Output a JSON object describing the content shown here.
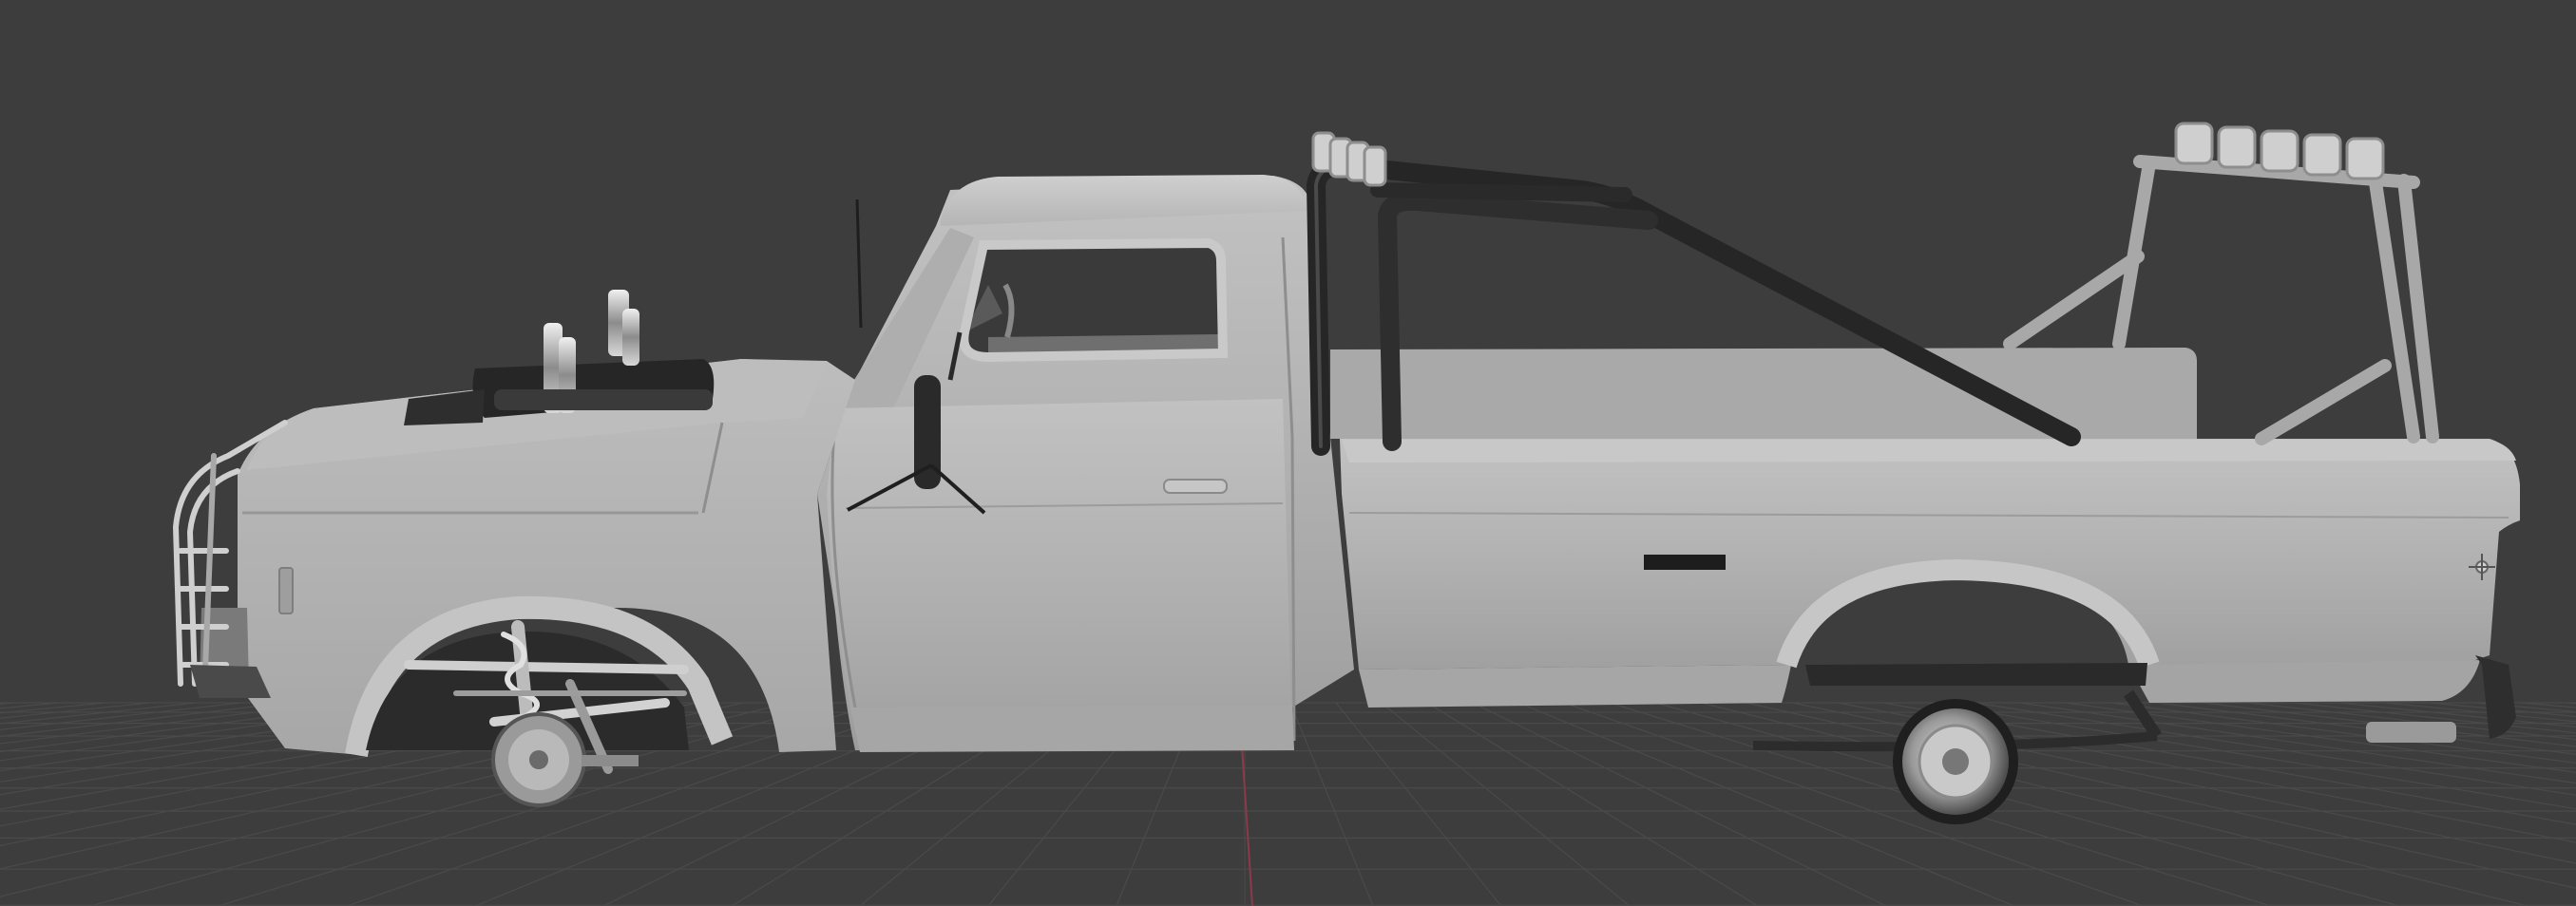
{
  "app": {
    "view": "3D viewport",
    "shading": "solid"
  },
  "viewport": {
    "background_color": "#3d3d3d",
    "grid_color": "#4a4a4a",
    "grid_major_color": "#555555",
    "y_axis_color": "#8a3a4a",
    "object_name": "pickup-truck-model",
    "object_body_color": "#b3b3b3",
    "object_dark_color": "#2e2e2e",
    "object_chrome_color": "#d0d0d0"
  }
}
